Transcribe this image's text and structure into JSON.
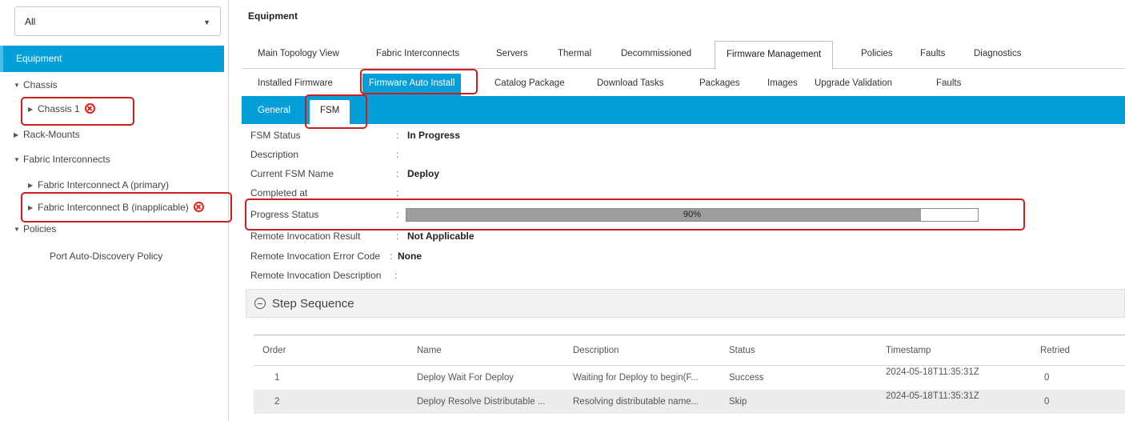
{
  "filter": {
    "value": "All"
  },
  "nav": {
    "equipment": "Equipment",
    "chassis": "Chassis",
    "chassis1": "Chassis 1",
    "rack_mounts": "Rack-Mounts",
    "fabric_interconnects": "Fabric Interconnects",
    "fi_a": "Fabric Interconnect A (primary)",
    "fi_b": "Fabric Interconnect B (inapplicable)",
    "policies": "Policies",
    "port_auto_discovery": "Port Auto-Discovery Policy"
  },
  "page_title": "Equipment",
  "tabs_main": [
    "Main Topology View",
    "Fabric Interconnects",
    "Servers",
    "Thermal",
    "Decommissioned",
    "Firmware Management",
    "Policies",
    "Faults",
    "Diagnostics"
  ],
  "tabs_firmware": [
    "Installed Firmware",
    "Firmware Auto Install",
    "Catalog Package",
    "Download Tasks",
    "Packages",
    "Images",
    "Upgrade Validation",
    "Faults"
  ],
  "tabs_sub": [
    "General",
    "FSM"
  ],
  "fsm": {
    "rows": [
      {
        "key": "FSM Status",
        "value": "In Progress"
      },
      {
        "key": "Description",
        "value": ""
      },
      {
        "key": "Current FSM Name",
        "value": "Deploy"
      },
      {
        "key": "Completed at",
        "value": ""
      },
      {
        "key": "Progress Status",
        "value": ""
      },
      {
        "key": "Remote Invocation Result",
        "value": "Not Applicable"
      },
      {
        "key": "Remote Invocation Error Code",
        "value": "None"
      },
      {
        "key": "Remote Invocation Description",
        "value": ""
      }
    ],
    "progress_percent": 90,
    "progress_label": "90%"
  },
  "step_sequence": {
    "label": "Step Sequence",
    "columns": [
      "Order",
      "Name",
      "Description",
      "Status",
      "Timestamp",
      "Retried"
    ],
    "rows": [
      [
        "1",
        "Deploy Wait For Deploy",
        "Waiting for Deploy to begin(F...",
        "Success",
        "2024-05-18T11:35:31Z",
        "0"
      ],
      [
        "2",
        "Deploy Resolve Distributable ...",
        "Resolving distributable name...",
        "Skip",
        "2024-05-18T11:35:31Z",
        "0"
      ]
    ]
  },
  "colors": {
    "accent": "#049fd9",
    "highlight_box": "#c8201f",
    "error": "#e2231a"
  }
}
